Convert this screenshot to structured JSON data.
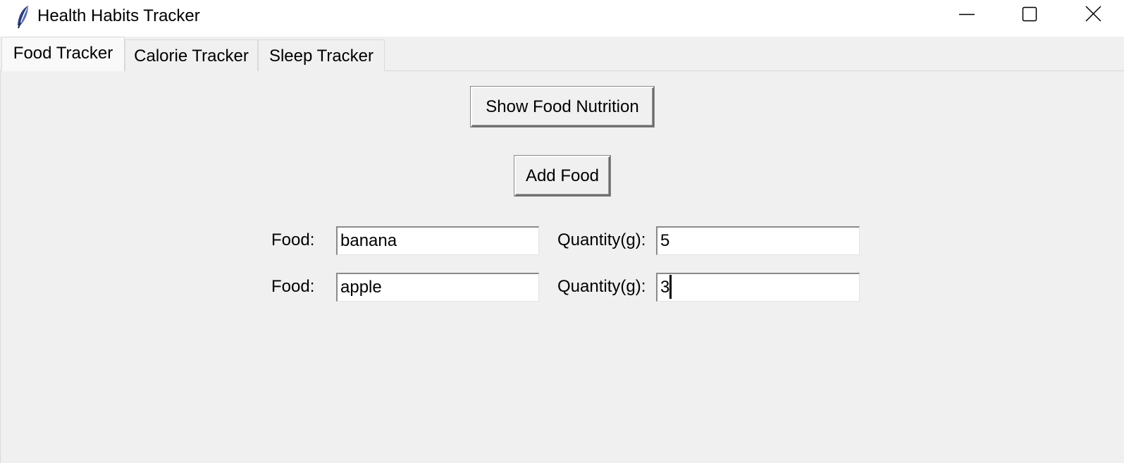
{
  "window": {
    "title": "Health Habits Tracker",
    "icon": "feather-icon",
    "controls": [
      "minimize-icon",
      "maximize-icon",
      "close-icon"
    ]
  },
  "tabs": [
    {
      "label": "Food Tracker",
      "active": true
    },
    {
      "label": "Calorie Tracker",
      "active": false
    },
    {
      "label": "Sleep Tracker",
      "active": false
    }
  ],
  "food_tracker": {
    "show_nutrition_label": "Show Food Nutrition",
    "add_food_label": "Add Food",
    "rows": [
      {
        "food_label": "Food:",
        "food_value": "banana",
        "quantity_label": "Quantity(g):",
        "quantity_value": "5"
      },
      {
        "food_label": "Food:",
        "food_value": "apple",
        "quantity_label": "Quantity(g):",
        "quantity_value": "3"
      }
    ]
  },
  "colors": {
    "background": "#f0f0f0",
    "titlebar": "#ffffff",
    "entry_background": "#ffffff",
    "active_tab": "#f9f9f9"
  }
}
